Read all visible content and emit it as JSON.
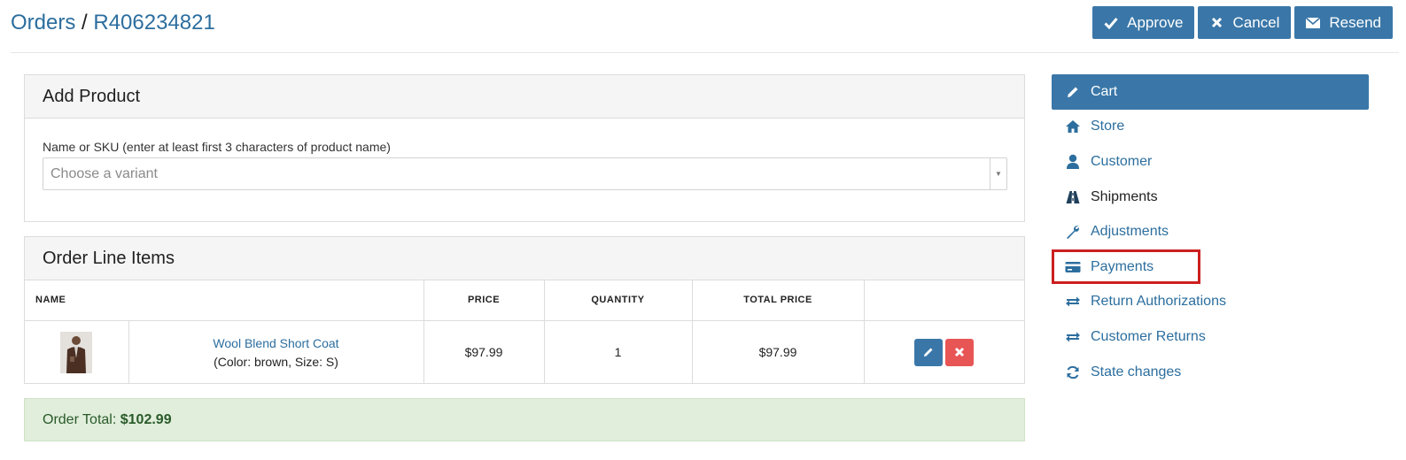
{
  "breadcrumb": {
    "parent": "Orders",
    "separator": "/",
    "current": "R406234821"
  },
  "actions": {
    "approve": {
      "label": "Approve",
      "icon": "checkmark-icon"
    },
    "cancel": {
      "label": "Cancel",
      "icon": "x-icon"
    },
    "resend": {
      "label": "Resend",
      "icon": "envelope-icon"
    }
  },
  "add_product": {
    "title": "Add Product",
    "field_label": "Name or SKU (enter at least first 3 characters of product name)",
    "placeholder": "Choose a variant"
  },
  "line_items": {
    "title": "Order Line Items",
    "columns": [
      "NAME",
      "PRICE",
      "QUANTITY",
      "TOTAL PRICE"
    ],
    "rows": [
      {
        "name": "Wool Blend Short Coat",
        "options": "(Color: brown, Size: S)",
        "price": "$97.99",
        "quantity": "1",
        "total": "$97.99"
      }
    ]
  },
  "order_total": {
    "label": "Order Total:",
    "value": "$102.99"
  },
  "sidebar": {
    "items": [
      {
        "label": "Cart",
        "icon": "pencil-icon",
        "active": true
      },
      {
        "label": "Store",
        "icon": "home-icon"
      },
      {
        "label": "Customer",
        "icon": "user-icon"
      },
      {
        "label": "Shipments",
        "icon": "road-icon"
      },
      {
        "label": "Adjustments",
        "icon": "wrench-icon"
      },
      {
        "label": "Payments",
        "icon": "credit-card-icon"
      },
      {
        "label": "Return Authorizations",
        "icon": "transfer-icon"
      },
      {
        "label": "Customer Returns",
        "icon": "transfer-icon"
      },
      {
        "label": "State changes",
        "icon": "refresh-icon"
      }
    ]
  },
  "colors": {
    "accent": "#3a77a8",
    "link": "#2c6e9e",
    "danger": "#e85555",
    "success_bg": "#e0eedb",
    "highlight": "#cc1f1f"
  }
}
